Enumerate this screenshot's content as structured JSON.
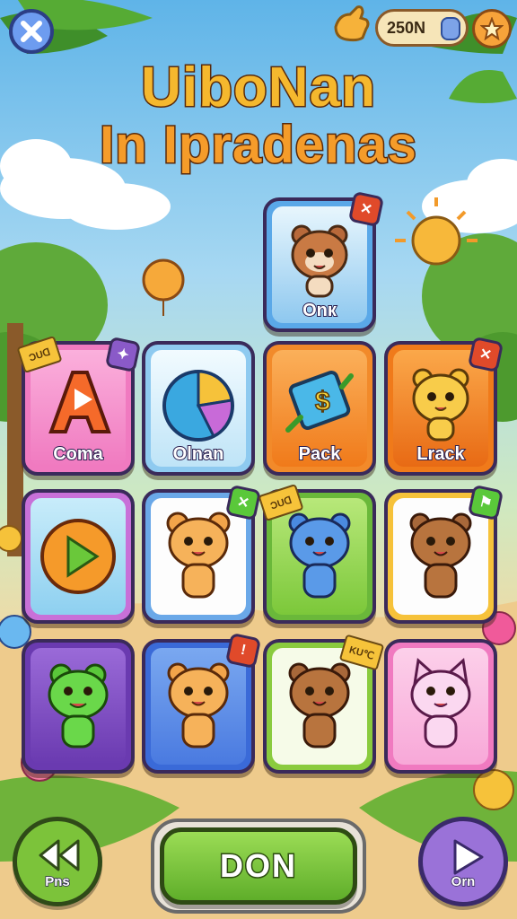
{
  "header": {
    "coins": "250N",
    "title_line1": "UiboNan",
    "title_line2": "In Ipradenas"
  },
  "tiles": [
    {
      "id": "featured",
      "label": "Onк"
    },
    {
      "id": "coma",
      "label": "Coma",
      "tag": "ƆUꓷ"
    },
    {
      "id": "olnan",
      "label": "Olnan"
    },
    {
      "id": "pack",
      "label": "Pack"
    },
    {
      "id": "lrack",
      "label": "Lrack"
    },
    {
      "id": "play",
      "label": ""
    },
    {
      "id": "bear-1",
      "label": ""
    },
    {
      "id": "monster-1",
      "label": "",
      "tag": "ƆUꓷ"
    },
    {
      "id": "bear-2",
      "label": ""
    },
    {
      "id": "frog",
      "label": ""
    },
    {
      "id": "tiger-1",
      "label": "",
      "badge": "!"
    },
    {
      "id": "bear-3",
      "label": "",
      "tag": "KU℃"
    },
    {
      "id": "cat",
      "label": ""
    }
  ],
  "footer": {
    "back_label": "Pns",
    "done_label": "DON",
    "next_label": "Orn"
  },
  "colors": {
    "pink": "#f07ac0",
    "light_blue": "#bfe4f7",
    "orange": "#f28a2a",
    "green": "#8acb3e",
    "purple": "#8a5ac8",
    "blue": "#5a86e0"
  }
}
